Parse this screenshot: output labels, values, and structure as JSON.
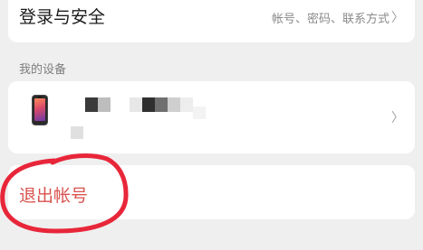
{
  "security": {
    "title": "登录与安全",
    "subtitle": "帐号、密码、联系方式",
    "chevron": "〉"
  },
  "devices": {
    "section_label": "我的设备",
    "device_icon": "phone-icon",
    "chevron": "〉"
  },
  "logout": {
    "label": "退出帐号"
  },
  "colors": {
    "background": "#efefef",
    "card": "#ffffff",
    "logout_text": "#d9534f",
    "annotation": "#e8263a"
  }
}
